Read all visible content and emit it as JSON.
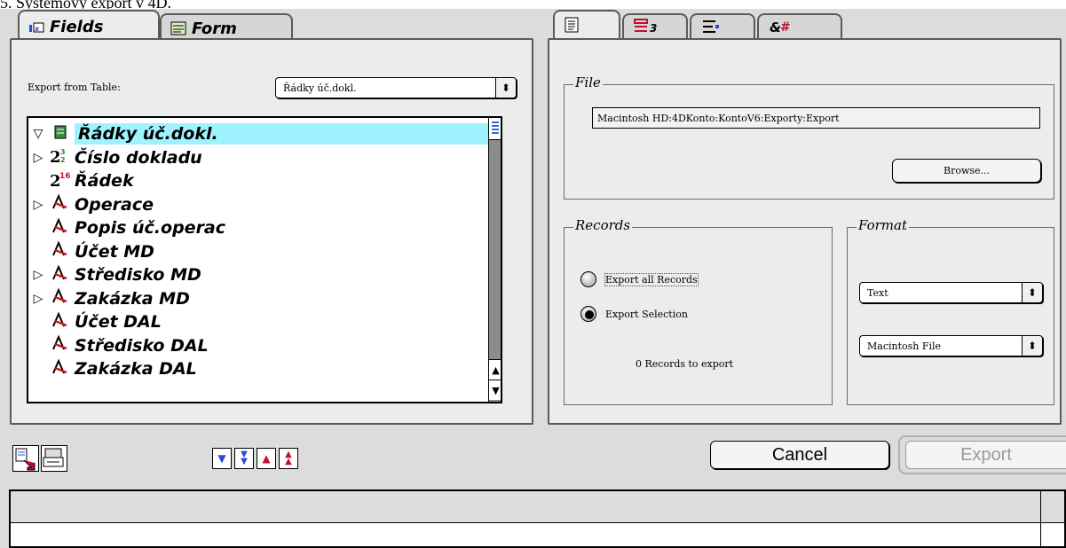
{
  "caption": "5. Systémový export v 4D.",
  "left_tabs": [
    {
      "label": "Fields",
      "icon": "fields-icon"
    },
    {
      "label": "Form",
      "icon": "form-icon"
    }
  ],
  "right_tabs": [
    {
      "icon": "file-settings-icon"
    },
    {
      "icon": "field-list-icon"
    },
    {
      "icon": "delimiter-icon"
    },
    {
      "icon": "char-map-icon"
    }
  ],
  "export_from_table": {
    "label": "Export from Table:",
    "value": "Řádky úč.dokl."
  },
  "tree": {
    "items": [
      {
        "disclosure": "▽",
        "icon": "table-icon",
        "label": "Řádky úč.dokl.",
        "selected": true
      },
      {
        "disclosure": "▷",
        "icon": "integer-icon",
        "label": "Číslo dokladu"
      },
      {
        "disclosure": "",
        "icon": "long-integer-icon",
        "label": "Řádek"
      },
      {
        "disclosure": "▷",
        "icon": "alpha-icon",
        "label": "Operace"
      },
      {
        "disclosure": "",
        "icon": "alpha-icon",
        "label": "Popis úč.operac"
      },
      {
        "disclosure": "",
        "icon": "alpha-icon",
        "label": "Účet MD"
      },
      {
        "disclosure": "▷",
        "icon": "alpha-icon",
        "label": "Středisko MD"
      },
      {
        "disclosure": "▷",
        "icon": "alpha-icon",
        "label": "Zakázka MD"
      },
      {
        "disclosure": "",
        "icon": "alpha-icon",
        "label": "Účet DAL"
      },
      {
        "disclosure": "",
        "icon": "alpha-icon",
        "label": "Středisko DAL"
      },
      {
        "disclosure": "",
        "icon": "alpha-icon",
        "label": "Zakázka DAL"
      }
    ]
  },
  "file": {
    "title": "File",
    "path": "Macintosh HD:4DKonto:KontoV6:Exporty:Export",
    "browse": "Browse..."
  },
  "records": {
    "title": "Records",
    "options": [
      "Export all Records",
      "Export Selection"
    ],
    "selected": 1,
    "count_text": "0 Records to export"
  },
  "format": {
    "title": "Format",
    "type": "Text",
    "destination": "Macintosh File"
  },
  "buttons": {
    "cancel": "Cancel",
    "export": "Export"
  },
  "colors": {
    "selection": "#9ff3ff",
    "dialog": "#dcdcdc"
  }
}
